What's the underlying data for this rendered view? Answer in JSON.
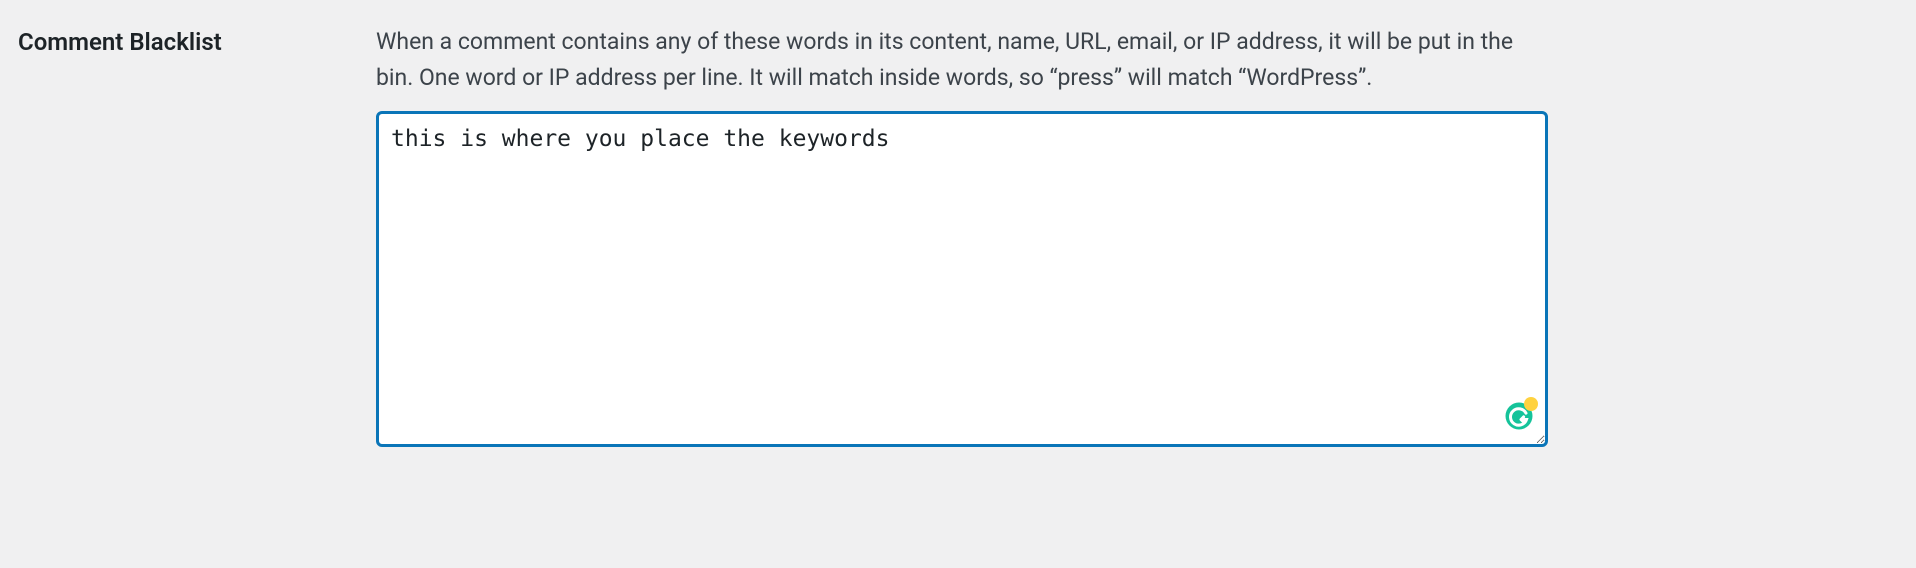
{
  "field": {
    "label": "Comment Blacklist",
    "description": "When a comment contains any of these words in its content, name, URL, email, or IP address, it will be put in the bin. One word or IP address per line. It will match inside words, so “press” will match “WordPress”.",
    "textarea_value": "this is where you place the keywords"
  }
}
